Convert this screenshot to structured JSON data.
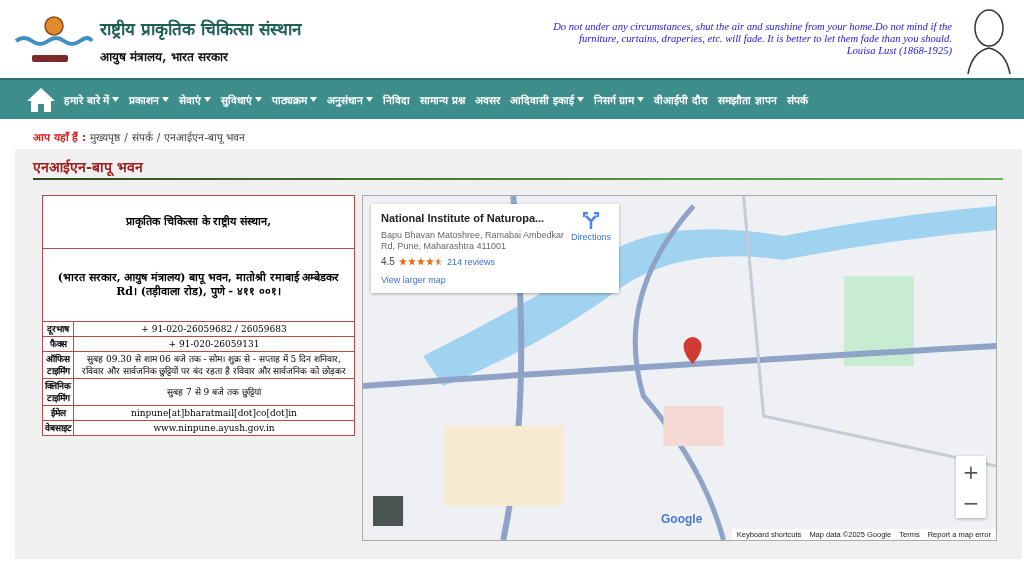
{
  "header": {
    "title": "राष्ट्रीय प्राकृतिक चिकित्सा संस्थान",
    "subtitle": "आयुष मंत्रालय, भारत सरकार",
    "quote": "Do not under any circumstances, shut the air and sunshine from your home.Do not mind if the furniture, curtains, draperies, etc. will fade. It is better to let them fade than you should.",
    "quote_author": "Louisa Lust (1868-1925)"
  },
  "nav": [
    {
      "label": "हमारे बारे में",
      "dropdown": true
    },
    {
      "label": "प्रकाशन",
      "dropdown": true
    },
    {
      "label": "सेवाएं",
      "dropdown": true
    },
    {
      "label": "सुविधाएं",
      "dropdown": true
    },
    {
      "label": "पाठ्यक्रम",
      "dropdown": true
    },
    {
      "label": "अनुसंधान",
      "dropdown": true
    },
    {
      "label": "निविदा",
      "dropdown": false
    },
    {
      "label": "सामान्य प्रश्न",
      "dropdown": false
    },
    {
      "label": "अवसर",
      "dropdown": false
    },
    {
      "label": "आदिवासी इकाई",
      "dropdown": true
    },
    {
      "label": "निसर्ग ग्राम",
      "dropdown": true
    },
    {
      "label": "वीआईपी दौरा",
      "dropdown": false
    },
    {
      "label": "समझौता ज्ञापन",
      "dropdown": false
    },
    {
      "label": "संपर्क",
      "dropdown": false
    }
  ],
  "breadcrumb": {
    "label": "आप यहाँ हैं :",
    "separator": "/",
    "items": [
      "मुख्यपृष्ठ",
      "संपर्क",
      "एनआईएन-बापू भवन"
    ]
  },
  "page_title": "एनआईएन-बापू भवन",
  "contact_table": {
    "heading": "प्राकृतिक चिकित्सा के राष्ट्रीय संस्थान,",
    "address": "(भारत सरकार, आयुष मंत्रालय) बापू भवन, मातोश्री रमाबाई अम्बेडकर Rd। (तड़ीवाला रोड), पुणे - ४११ ००१।",
    "rows": [
      {
        "label": "दूरभाष",
        "value": "+ 91-020-26059682 / 26059683"
      },
      {
        "label": "फैक्स",
        "value": "+ 91-020-26059131"
      },
      {
        "label": "ऑफिस टाइमिंग",
        "value": "सुबह 09.30 से शाम 06 बजे तक - सोम। शुक्र से - सप्ताह में 5 दिन शनिवार, रविवार और सार्वजनिक छुट्टियों पर बंद रहता है रविवार और सार्वजनिक को छोड़कर"
      },
      {
        "label": "क्लिनिक टाइमिंग",
        "value": "सुबह 7 से 9 बजे तक   छुट्टियां"
      },
      {
        "label": "ईमेल",
        "value": "ninpune[at]bharatmail[dot]co[dot]in"
      },
      {
        "label": "वेबसाइट",
        "value": "www.ninpune.ayush.gov.in"
      }
    ]
  },
  "map": {
    "card": {
      "title": "National Institute of Naturopa...",
      "address": "Bapu Bhavan Matoshree, Ramabai Ambedkar Rd, Pune, Maharashtra 411001",
      "rating": "4.5",
      "stars": 4.5,
      "reviews": "214 reviews",
      "directions": "Directions",
      "larger_map": "View larger map"
    },
    "zoom_in": "+",
    "zoom_out": "−",
    "google": "Google",
    "footer": [
      "Keyboard shortcuts",
      "Map data ©2025 Google",
      "Terms",
      "Report a map error"
    ]
  }
}
